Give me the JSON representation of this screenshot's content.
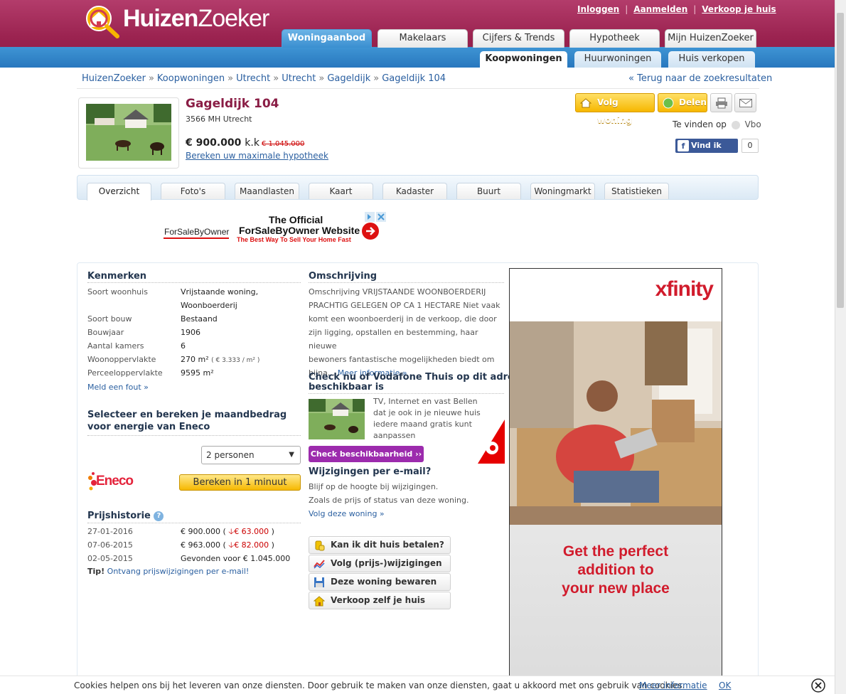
{
  "header": {
    "logo_bold": "Huizen",
    "logo_thin": "Zoeker",
    "top_links": [
      "Inloggen",
      "Aanmelden",
      "Verkoop je huis"
    ],
    "main_tabs": [
      "Woningaanbod",
      "Makelaars",
      "Cijfers & Trends",
      "Hypotheek",
      "Mijn HuizenZoeker"
    ],
    "sub_tabs": [
      "Koopwoningen",
      "Huurwoningen",
      "Huis verkopen"
    ]
  },
  "breadcrumb": [
    "HuizenZoeker",
    "Koopwoningen",
    "Utrecht",
    "Utrecht",
    "Gageldijk",
    "Gageldijk 104"
  ],
  "back_link": "« Terug naar de zoekresultaten",
  "property": {
    "title": "Gageldijk 104",
    "postcode_city": "3566 MH Utrecht",
    "price": "€ 900.000",
    "price_suffix": "k.k",
    "old_price": "€ 1.045.000",
    "hypotheek_link": "Bereken uw maximale hypotheek"
  },
  "actions": {
    "follow": "Volg woning",
    "share": "Delen",
    "te_vinden_op": "Te vinden op",
    "vbo": "Vbo",
    "fb_like": "Vind ik leuk",
    "fb_count": "0"
  },
  "detail_tabs": [
    "Overzicht",
    "Foto's",
    "Maandlasten",
    "Kaart",
    "Kadaster",
    "Buurt",
    "Woningmarkt",
    "Statistieken"
  ],
  "ad_banner": {
    "brand": "ForSaleByOwner",
    "line1": "The Official",
    "line2": "ForSaleByOwner Website",
    "line3": "The Best Way To Sell Your Home Fast"
  },
  "kenmerken": {
    "title": "Kenmerken",
    "rows": [
      {
        "label": "Soort woonhuis",
        "value": "Vrijstaande woning,"
      },
      {
        "label": "",
        "value": "Woonboerderij"
      },
      {
        "label": "Soort bouw",
        "value": "Bestaand"
      },
      {
        "label": "Bouwjaar",
        "value": "1906"
      },
      {
        "label": "Aantal kamers",
        "value": "6"
      },
      {
        "label": "Woonoppervlakte",
        "value": "270 m²"
      },
      {
        "label": "Perceeloppervlakte",
        "value": "9595 m²"
      }
    ],
    "woon_extra": "( € 3.333 / m² )",
    "meld_fout": "Meld een fout »"
  },
  "energie": {
    "title_line1": "Selecteer en bereken je maandbedrag",
    "title_line2": "voor energie van Eneco",
    "select_value": "2 personen",
    "eneco_logo": "Eneco",
    "calc_button": "Bereken in 1 minuut"
  },
  "prijshistorie": {
    "title": "Prijshistorie",
    "rows": [
      {
        "date": "27-01-2016",
        "price": "€ 900.000",
        "change": "€ 63.000"
      },
      {
        "date": "07-06-2015",
        "price": "€ 963.000",
        "change": "€ 82.000"
      },
      {
        "date": "02-05-2015",
        "price": "Gevonden voor € 1.045.000",
        "change": ""
      }
    ],
    "tip_label": "Tip!",
    "tip_link": "Ontvang prijswijzigingen per e-mail!"
  },
  "omschrijving": {
    "title": "Omschrijving",
    "lines": [
      "Omschrijving VRIJSTAANDE WOONBOERDERIJ",
      "PRACHTIG GELEGEN OP CA 1 HECTARE Niet vaak",
      "komt een woonboerderij in de verkoop, die door",
      "zijn ligging, opstallen en bestemming, haar nieuwe",
      "bewoners fantastische mogelijkheden biedt om",
      "bijna..."
    ],
    "more": "Meer informatie »"
  },
  "vodafone": {
    "title_line1": "Check nu of Vodafone Thuis op dit adres",
    "title_line2": "beschikbaar is",
    "lines": [
      "TV, Internet en vast Bellen",
      "dat je ook in je nieuwe huis",
      "iedere maand gratis kunt",
      "aanpassen"
    ],
    "button": "Check beschikbaarheid ››"
  },
  "wijzigingen": {
    "title": "Wijzigingen per e-mail?",
    "line1": "Blijf op de hoogte bij wijzigingen.",
    "line2": "Zoals de prijs of status van deze woning.",
    "link": "Volg deze woning »"
  },
  "link_buttons": [
    "Kan ik dit huis betalen?",
    "Volg (prijs-)wijzigingen",
    "Deze woning bewaren",
    "Verkoop zelf je huis"
  ],
  "xfinity": {
    "logo": "xfinity",
    "line1": "Get the perfect",
    "line2": "addition to",
    "line3": "your new place"
  },
  "cookie": {
    "text": "Cookies helpen ons bij het leveren van onze diensten. Door gebruik te maken van onze diensten, gaat u akkoord met ons gebruik van cookies.",
    "more": "Meer informatie",
    "ok": "OK"
  },
  "colors": {
    "brand": "#9b2350",
    "blue": "#2877be",
    "link": "#2a5fa0",
    "yellow": "#f6b700",
    "red": "#c00000"
  }
}
